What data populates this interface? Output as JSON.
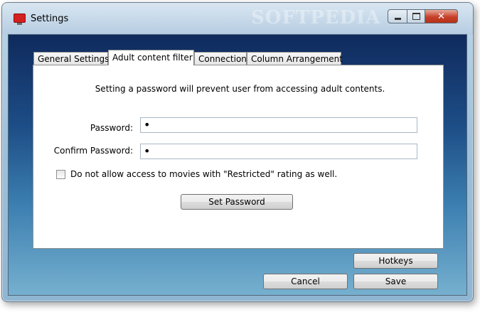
{
  "window": {
    "title": "Settings",
    "watermark": "SOFTPEDIA",
    "close_glyph": "✕"
  },
  "tabs": [
    {
      "label": "General Settings",
      "active": false
    },
    {
      "label": "Adult content filter",
      "active": true
    },
    {
      "label": "Connection",
      "active": false
    },
    {
      "label": "Column Arrangement",
      "active": false
    }
  ],
  "filter": {
    "info_text": "Setting a password will prevent user from accessing adult contents.",
    "password_label": "Password:",
    "password_value": "•",
    "confirm_label": "Confirm Password:",
    "confirm_value": "•",
    "restricted_checkbox_label": "Do not allow access to movies with \"Restricted\" rating as well.",
    "restricted_checked": false,
    "set_password_label": "Set Password"
  },
  "buttons": {
    "hotkeys": "Hotkeys",
    "cancel": "Cancel",
    "save": "Save"
  }
}
